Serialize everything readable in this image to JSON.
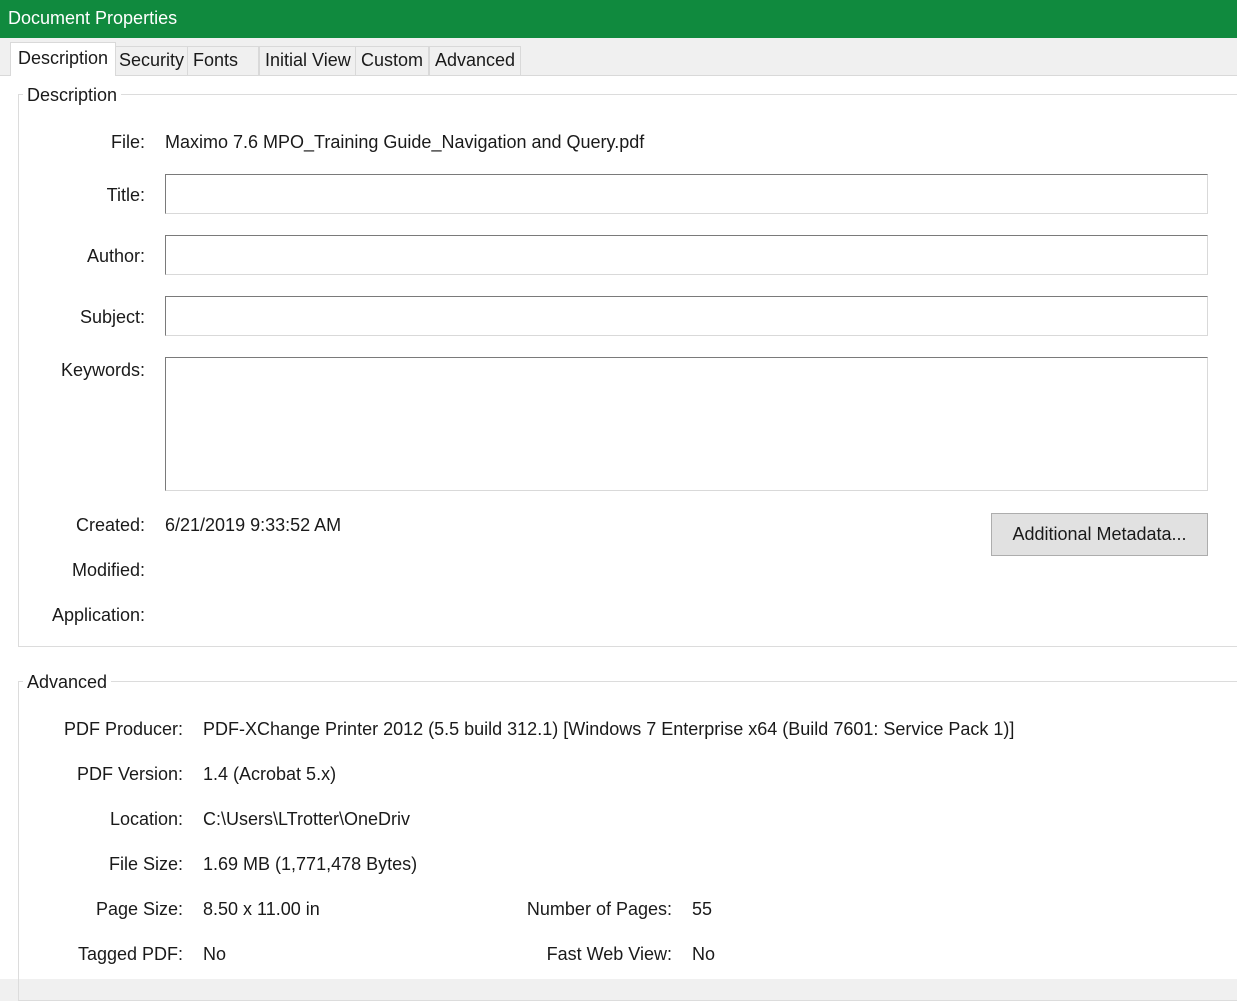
{
  "window": {
    "title": "Document Properties"
  },
  "tabs": [
    {
      "label": "Description",
      "active": true
    },
    {
      "label": "Security",
      "active": false
    },
    {
      "label": "Fonts",
      "active": false
    },
    {
      "label": "Initial View",
      "active": false
    },
    {
      "label": "Custom",
      "active": false
    },
    {
      "label": "Advanced",
      "active": false
    }
  ],
  "description": {
    "group_label": "Description",
    "file_label": "File:",
    "file_value": "Maximo 7.6 MPO_Training Guide_Navigation and Query.pdf",
    "title_label": "Title:",
    "title_value": "",
    "author_label": "Author:",
    "author_value": "",
    "subject_label": "Subject:",
    "subject_value": "",
    "keywords_label": "Keywords:",
    "keywords_value": "",
    "created_label": "Created:",
    "created_value": "6/21/2019 9:33:52 AM",
    "modified_label": "Modified:",
    "modified_value": "",
    "application_label": "Application:",
    "application_value": "",
    "metadata_button": "Additional Metadata..."
  },
  "advanced": {
    "group_label": "Advanced",
    "producer_label": "PDF Producer:",
    "producer_value": "PDF-XChange Printer 2012 (5.5 build 312.1) [Windows 7 Enterprise x64 (Build 7601: Service Pack 1)]",
    "version_label": "PDF Version:",
    "version_value": "1.4 (Acrobat 5.x)",
    "location_label": "Location:",
    "location_value": "C:\\Users\\LTrotter\\OneDriv",
    "filesize_label": "File Size:",
    "filesize_value": "1.69 MB (1,771,478 Bytes)",
    "pagesize_label": "Page Size:",
    "pagesize_value": "8.50 x 11.00 in",
    "numpages_label": "Number of Pages:",
    "numpages_value": "55",
    "tagged_label": "Tagged PDF:",
    "tagged_value": "No",
    "fastweb_label": "Fast Web View:",
    "fastweb_value": "No"
  },
  "colors": {
    "titlebar": "#108a3e",
    "window_bg": "#f0f0f0",
    "content_bg": "#ffffff"
  }
}
